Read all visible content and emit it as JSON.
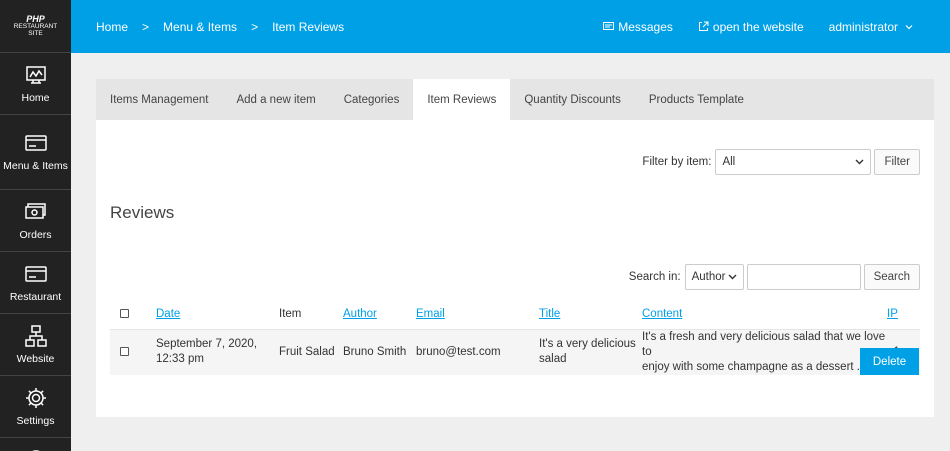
{
  "logo": {
    "line1": "PHP",
    "line2": "RESTAURANT",
    "line3": "SITE"
  },
  "sidebar": {
    "items": [
      {
        "label": "Home",
        "icon": "dashboard-icon"
      },
      {
        "label": "Menu & Items",
        "icon": "card-icon"
      },
      {
        "label": "Orders",
        "icon": "cash-icon"
      },
      {
        "label": "Restaurant",
        "icon": "card-icon"
      },
      {
        "label": "Website",
        "icon": "sitemap-icon"
      },
      {
        "label": "Settings",
        "icon": "gear-icon"
      }
    ]
  },
  "topbar": {
    "crumbs": [
      "Home",
      "Menu & Items",
      "Item Reviews"
    ],
    "separator": ">",
    "messages": "Messages",
    "open_site": "open the website",
    "user": "administrator"
  },
  "tabs": [
    "Items Management",
    "Add a new item",
    "Categories",
    "Item Reviews",
    "Quantity Discounts",
    "Products Template"
  ],
  "active_tab": "Item Reviews",
  "filter": {
    "label": "Filter by item:",
    "value": "All",
    "button": "Filter"
  },
  "reviews_title": "Reviews",
  "search": {
    "label": "Search in:",
    "field": "Author",
    "value": "",
    "button": "Search"
  },
  "table": {
    "headers": {
      "date": "Date",
      "item": "Item",
      "author": "Author",
      "email": "Email",
      "title": "Title",
      "content": "Content",
      "ip": "IP"
    },
    "rows": [
      {
        "date_l1": "September 7, 2020,",
        "date_l2": "12:33 pm",
        "item": "Fruit Salad",
        "author": "Bruno Smith",
        "email": "bruno@test.com",
        "title_l1": "It's a very delicious",
        "title_l2": "salad",
        "content_l1": "It's a fresh and very delicious salad that we love to",
        "content_l2": "enjoy with some champagne as a dessert ....",
        "ip": "::1"
      }
    ]
  },
  "delete_button": "Delete",
  "colors": {
    "accent": "#00a0e6",
    "sidebar": "#222222"
  }
}
